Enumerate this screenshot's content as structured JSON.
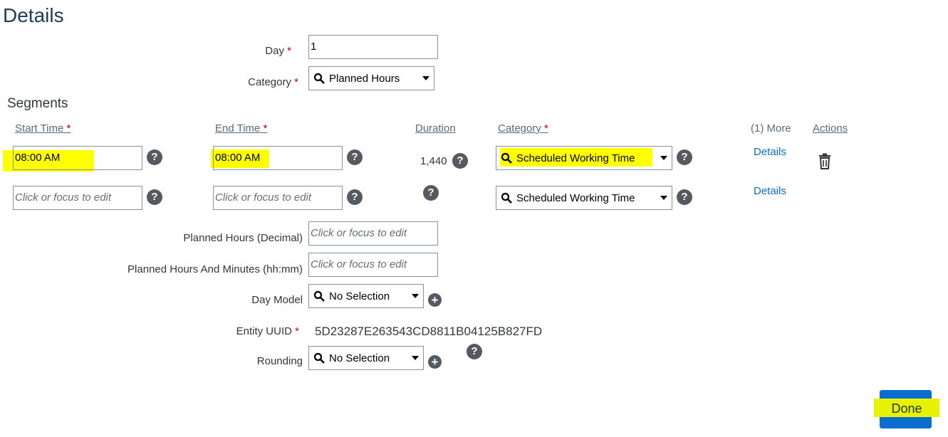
{
  "page": {
    "title": "Details"
  },
  "header_fields": {
    "day": {
      "label": "Day",
      "required_marker": "*",
      "value": "1"
    },
    "category": {
      "label": "Category",
      "required_marker": "*",
      "value": "Planned Hours"
    }
  },
  "segments": {
    "title": "Segments",
    "columns": {
      "start_time": "Start Time",
      "end_time": "End Time",
      "duration": "Duration",
      "category": "Category",
      "more": "(1) More",
      "actions": "Actions",
      "required_marker": "*"
    },
    "rows": [
      {
        "start_time": "08:00 AM",
        "end_time": "08:00 AM",
        "duration": "1,440",
        "category": "Scheduled Working Time",
        "details_link": "Details",
        "has_delete": true
      },
      {
        "start_time_placeholder": "Click or focus to edit",
        "end_time_placeholder": "Click or focus to edit",
        "duration": "",
        "category": "Scheduled Working Time",
        "details_link": "Details",
        "has_delete": false
      }
    ]
  },
  "lower_fields": {
    "planned_hours_decimal": {
      "label": "Planned Hours (Decimal)",
      "placeholder": "Click or focus to edit"
    },
    "planned_hours_hhmm": {
      "label": "Planned Hours And Minutes (hh:mm)",
      "placeholder": "Click or focus to edit"
    },
    "day_model": {
      "label": "Day Model",
      "value": "No Selection"
    },
    "entity_uuid": {
      "label": "Entity UUID",
      "required_marker": "*",
      "value": "5D23287E263543CD8811B04125B827FD"
    },
    "rounding": {
      "label": "Rounding",
      "value": "No Selection"
    }
  },
  "footer": {
    "done_label": "Done"
  },
  "icons": {
    "help": "?",
    "add": "+",
    "search": "search-icon",
    "delete": "trash-icon"
  },
  "colors": {
    "accent": "#0a6ed1",
    "required": "#bb0000",
    "highlight": "#ffff00",
    "title": "#1d3d5c"
  }
}
